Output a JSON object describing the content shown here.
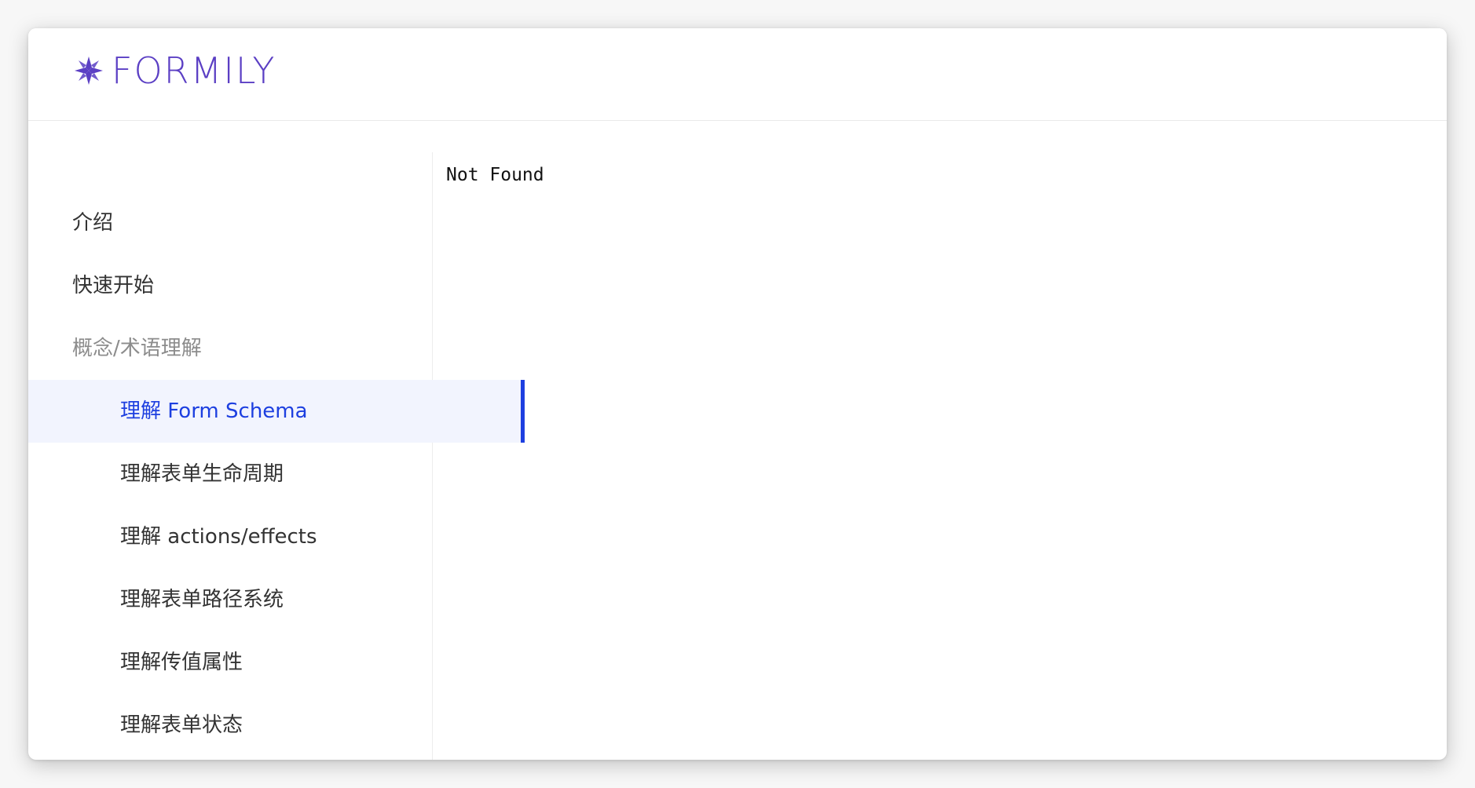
{
  "header": {
    "logo_text": "FORMILY",
    "logo_icon": "formily-logo-icon",
    "brand_color": "#5b3fc4"
  },
  "sidebar": {
    "items": [
      {
        "label": "介绍"
      },
      {
        "label": "快速开始"
      },
      {
        "label": "概念/术语理解"
      },
      {
        "label": "理解 Form Schema"
      },
      {
        "label": "理解表单生命周期"
      },
      {
        "label": "理解 actions/effects"
      },
      {
        "label": "理解表单路径系统"
      },
      {
        "label": "理解传值属性"
      },
      {
        "label": "理解表单状态"
      }
    ],
    "active_color": "#1d3fe0"
  },
  "main": {
    "message": "Not Found"
  }
}
